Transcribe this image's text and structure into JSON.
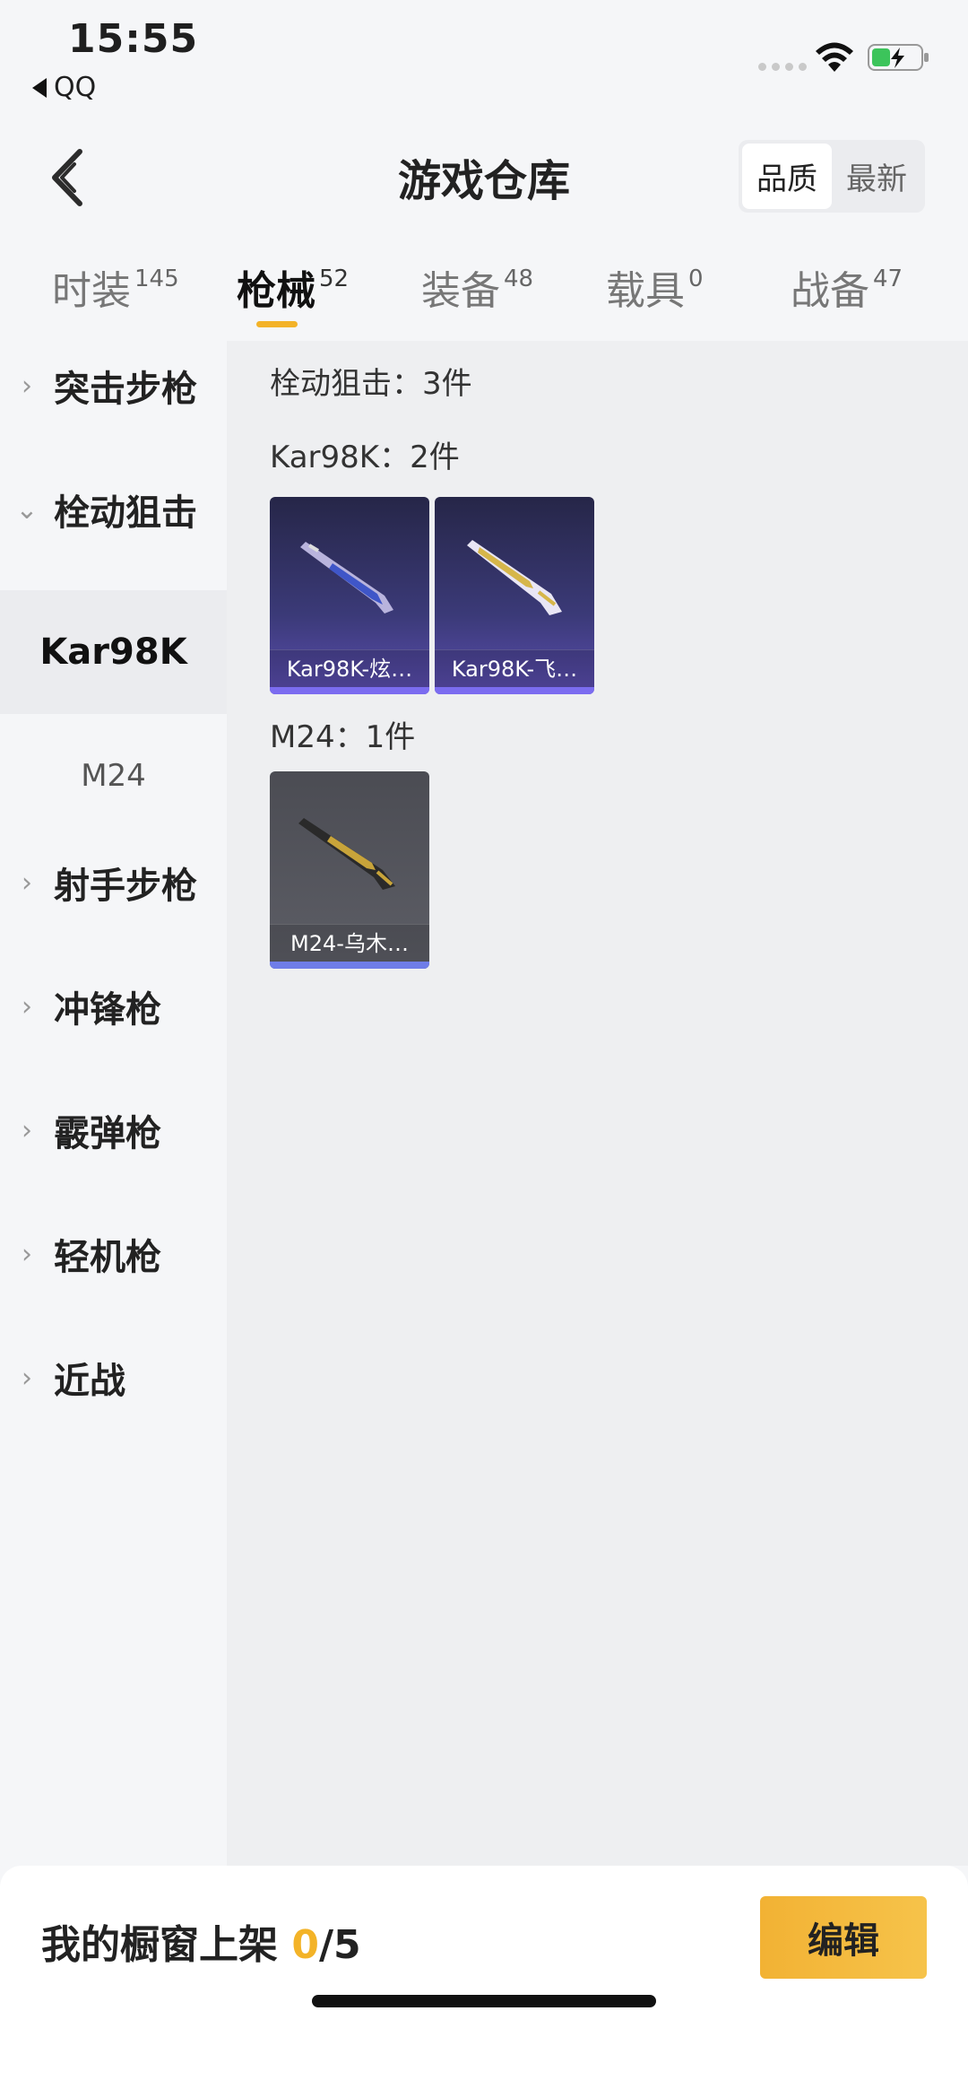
{
  "status_bar": {
    "time": "15:55",
    "back_app": "QQ"
  },
  "header": {
    "title": "游戏仓库",
    "sort_options": [
      "品质",
      "最新"
    ],
    "sort_selected": "品质"
  },
  "tabs": [
    {
      "label": "时装",
      "count": "145"
    },
    {
      "label": "枪械",
      "count": "52"
    },
    {
      "label": "装备",
      "count": "48"
    },
    {
      "label": "载具",
      "count": "0"
    },
    {
      "label": "战备",
      "count": "47"
    }
  ],
  "sidebar": {
    "categories": [
      {
        "label": "突击步枪"
      },
      {
        "label": "栓动狙击"
      },
      {
        "label": "射手步枪"
      },
      {
        "label": "冲锋枪"
      },
      {
        "label": "霰弹枪"
      },
      {
        "label": "轻机枪"
      },
      {
        "label": "近战"
      }
    ],
    "subitems": [
      {
        "label": "Kar98K"
      },
      {
        "label": "M24"
      }
    ]
  },
  "content": {
    "category_total": "栓动狙击：3件",
    "groups": [
      {
        "title": "Kar98K：2件",
        "items": [
          {
            "name": "Kar98K-炫…",
            "color": "#5b4db0"
          },
          {
            "name": "Kar98K-飞…",
            "color": "#5b4db0"
          }
        ]
      },
      {
        "title": "M24：1件",
        "items": [
          {
            "name": "M24-乌木…",
            "color": "#5d5e66"
          }
        ]
      }
    ]
  },
  "bottom_bar": {
    "showcase_label": "我的橱窗上架 ",
    "showcase_count": "0",
    "showcase_total": "/5",
    "edit_label": "编辑"
  },
  "colors": {
    "accent": "#f3b328",
    "epic": "#7b6cf0"
  }
}
